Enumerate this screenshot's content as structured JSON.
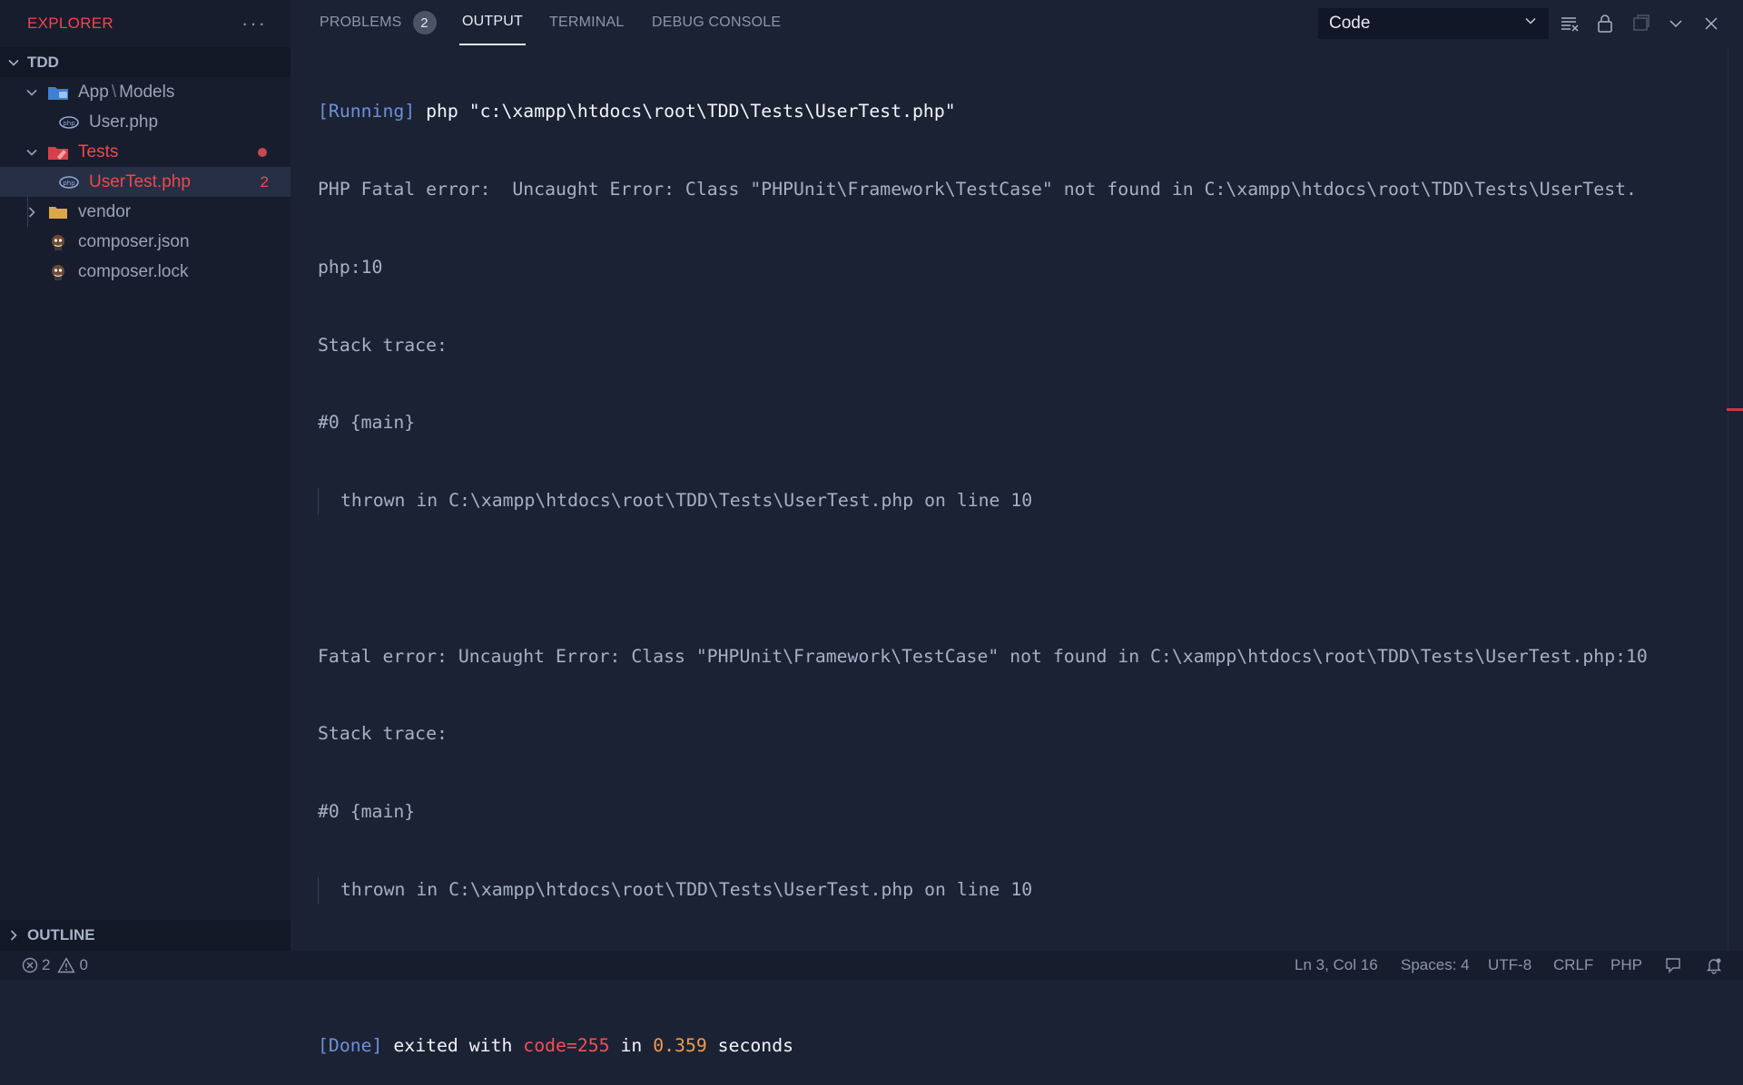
{
  "sidebar": {
    "title": "EXPLORER",
    "more": "···",
    "root": "TDD",
    "items": [
      {
        "label": "App",
        "sep": "\\",
        "label2": "Models"
      },
      {
        "label": "User.php"
      },
      {
        "label": "Tests"
      },
      {
        "label": "UserTest.php",
        "badge": "2"
      },
      {
        "label": "vendor"
      },
      {
        "label": "composer.json"
      },
      {
        "label": "composer.lock"
      }
    ],
    "outline": "OUTLINE"
  },
  "panel": {
    "tabs": [
      {
        "label": "PROBLEMS",
        "count": "2"
      },
      {
        "label": "OUTPUT"
      },
      {
        "label": "TERMINAL"
      },
      {
        "label": "DEBUG CONSOLE"
      }
    ],
    "select_value": "Code"
  },
  "output": {
    "l1_tag": "[Running]",
    "l1_cmd": " php \"c:\\xampp\\htdocs\\root\\TDD\\Tests\\UserTest.php\"",
    "l2": "PHP Fatal error:  Uncaught Error: Class \"PHPUnit\\Framework\\TestCase\" not found in C:\\xampp\\htdocs\\root\\TDD\\Tests\\UserTest.",
    "l3": "php:10",
    "l4": "Stack trace:",
    "l5": "#0 {main}",
    "l6": "thrown in C:\\xampp\\htdocs\\root\\TDD\\Tests\\UserTest.php on line 10",
    "l8": "Fatal error: Uncaught Error: Class \"PHPUnit\\Framework\\TestCase\" not found in C:\\xampp\\htdocs\\root\\TDD\\Tests\\UserTest.php:10",
    "l9": "Stack trace:",
    "l10": "#0 {main}",
    "l11": "thrown in C:\\xampp\\htdocs\\root\\TDD\\Tests\\UserTest.php on line 10",
    "done_tag": "[Done]",
    "done_a": " exited with ",
    "done_code": "code=255",
    "done_b": " in ",
    "done_time": "0.359",
    "done_c": " seconds"
  },
  "status": {
    "errors": "2",
    "warnings": "0",
    "position": "Ln 3, Col 16",
    "spaces": "Spaces: 4",
    "encoding": "UTF-8",
    "eol": "CRLF",
    "language": "PHP"
  },
  "colors": {
    "accent_red": "#f0474e",
    "background": "#1b2233",
    "sidebar_bg": "#171d2c"
  }
}
